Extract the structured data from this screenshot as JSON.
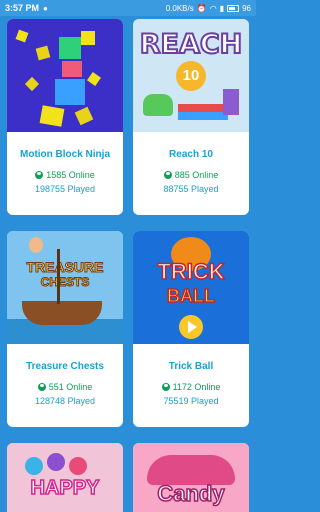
{
  "status": {
    "time": "3:57 PM",
    "speed": "0.0KB/s",
    "battery": "96"
  },
  "games": [
    {
      "title": "Motion Block Ninja",
      "online": "1585 Online",
      "played": "198755 Played"
    },
    {
      "title": "Reach 10",
      "online": "885 Online",
      "played": "88755 Played",
      "logo": "REACH",
      "logo_sub": "10"
    },
    {
      "title": "Treasure Chests",
      "online": "551 Online",
      "played": "128748 Played",
      "logo": "TREASURE",
      "logo_sub": "CHESTS"
    },
    {
      "title": "Trick Ball",
      "online": "1172 Online",
      "played": "75519 Played",
      "logo": "TRICK",
      "logo_sub": "BALL"
    },
    {
      "logo": "HAPPY"
    },
    {
      "logo": "Candy"
    }
  ]
}
